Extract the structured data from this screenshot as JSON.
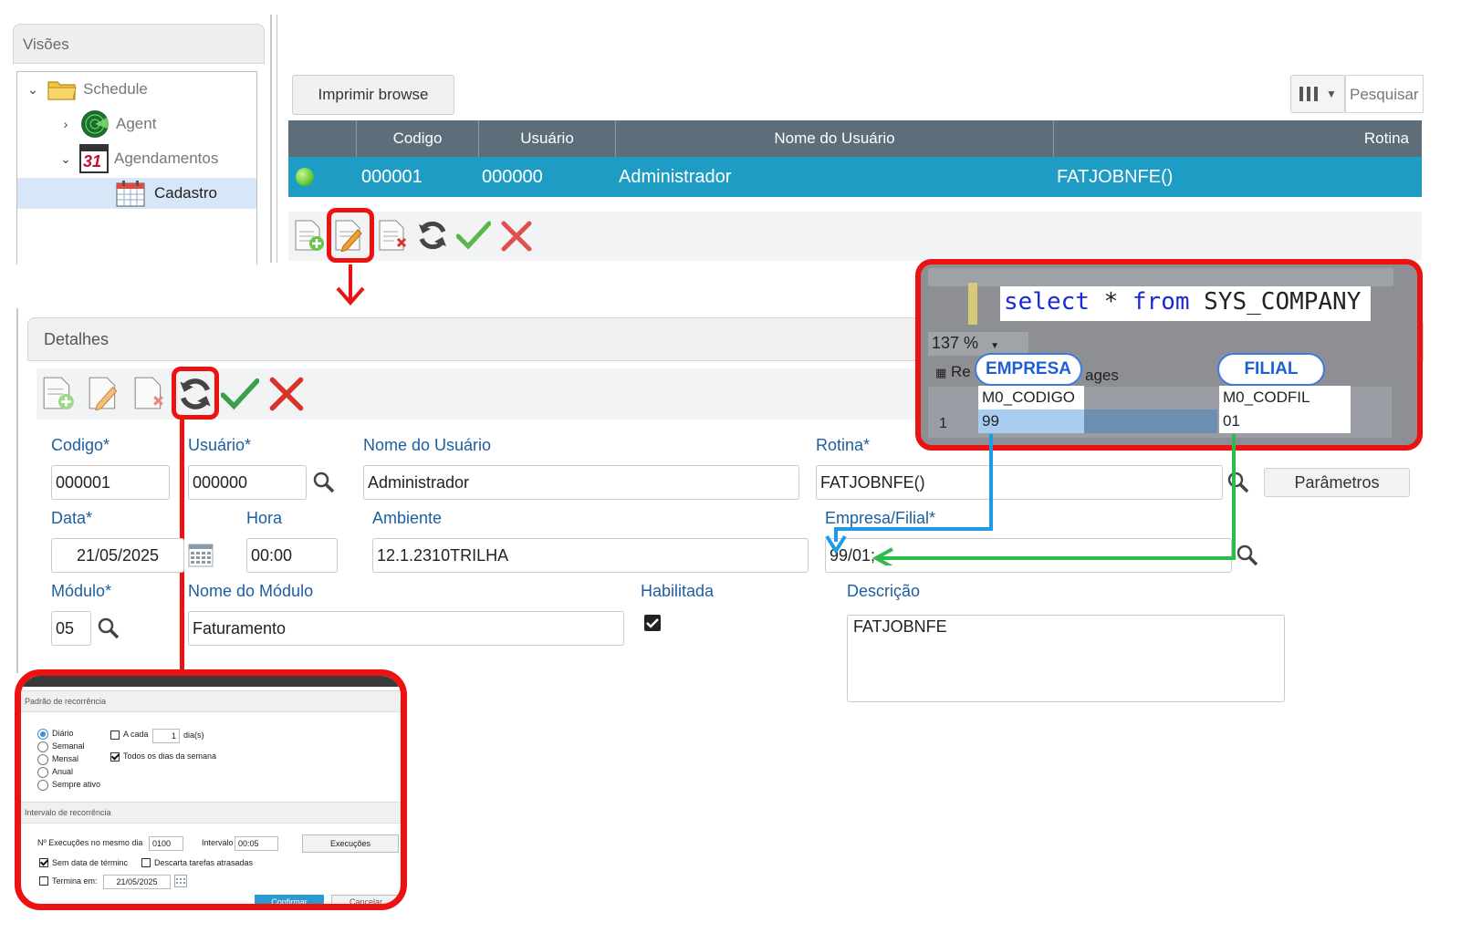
{
  "visoes": {
    "title": "Visões",
    "tree": [
      {
        "label": "Schedule"
      },
      {
        "label": "Agent"
      },
      {
        "label": "Agendamentos"
      },
      {
        "label": "Cadastro"
      }
    ],
    "calendar_icon_day": "31"
  },
  "browse": {
    "print_label": "Imprimir browse",
    "search_placeholder": "Pesquisar",
    "columns": [
      "Codigo",
      "Usuário",
      "Nome do Usuário",
      "Rotina"
    ],
    "row": {
      "codigo": "000001",
      "usuario": "000000",
      "nome": "Administrador",
      "rotina": "FATJOBNFE()"
    },
    "status_color": "#6ccf3a",
    "header_color": "#5d6d79",
    "row_color": "#1e9cc4"
  },
  "detalhes": {
    "title": "Detalhes",
    "labels": {
      "codigo": "Codigo*",
      "usuario": "Usuário*",
      "nome_usuario": "Nome do Usuário",
      "rotina": "Rotina*",
      "data": "Data*",
      "hora": "Hora",
      "ambiente": "Ambiente",
      "empresa_filial": "Empresa/Filial*",
      "modulo": "Módulo*",
      "nome_modulo": "Nome do Módulo",
      "habilitada": "Habilitada",
      "descricao": "Descrição"
    },
    "values": {
      "codigo": "000001",
      "usuario": "000000",
      "nome_usuario": "Administrador",
      "rotina": "FATJOBNFE()",
      "data": "21/05/2025",
      "hora": "00:00",
      "ambiente": "12.1.2310TRILHA",
      "empresa_filial": "99/01;",
      "modulo": "05",
      "nome_modulo": "Faturamento",
      "descricao": "FATJOBNFE"
    },
    "habilitada_checked": true,
    "params_label": "Parâmetros"
  },
  "sql": {
    "kw_select": "select",
    "star": "*",
    "kw_from": "from",
    "table": "SYS_COMPANY",
    "zoom": "137 %",
    "tab_prefix": "Re",
    "tab_suffix": "ages",
    "empresa_pill": "EMPRESA",
    "filial_pill": "FILIAL",
    "col1": "M0_CODIGO",
    "col2": "M0_CODFIL",
    "rownum": "1",
    "val1": "99",
    "val2": "01"
  },
  "recurrence": {
    "pattern_title": "Padrão de recorrência",
    "options": [
      "Diário",
      "Semanal",
      "Mensal",
      "Anual",
      "Sempre ativo"
    ],
    "selected": "Diário",
    "a_cada_label": "A cada",
    "a_cada_value": "1",
    "dias_label": "dia(s)",
    "todos_dias_label": "Todos os dias da semana",
    "interval_title": "Intervalo de recorrência",
    "execucoes_label": "Nº Execuções no mesmo dia",
    "execucoes_value": "0100",
    "intervalo_label": "Intervalo",
    "intervalo_value": "00:05",
    "execucoes_button": "Execuções",
    "sem_data_label": "Sem data de términc",
    "descarta_label": "Descarta tarefas atrasadas",
    "termina_label": "Termina em:",
    "termina_value": "21/05/2025",
    "confirmar": "Confirmar",
    "cancelar": "Cancelar"
  },
  "colors": {
    "highlight": "#ee1111",
    "blue_arrow": "#1e9be8",
    "green_arrow": "#2dbb4a",
    "label": "#1c5f9c"
  }
}
